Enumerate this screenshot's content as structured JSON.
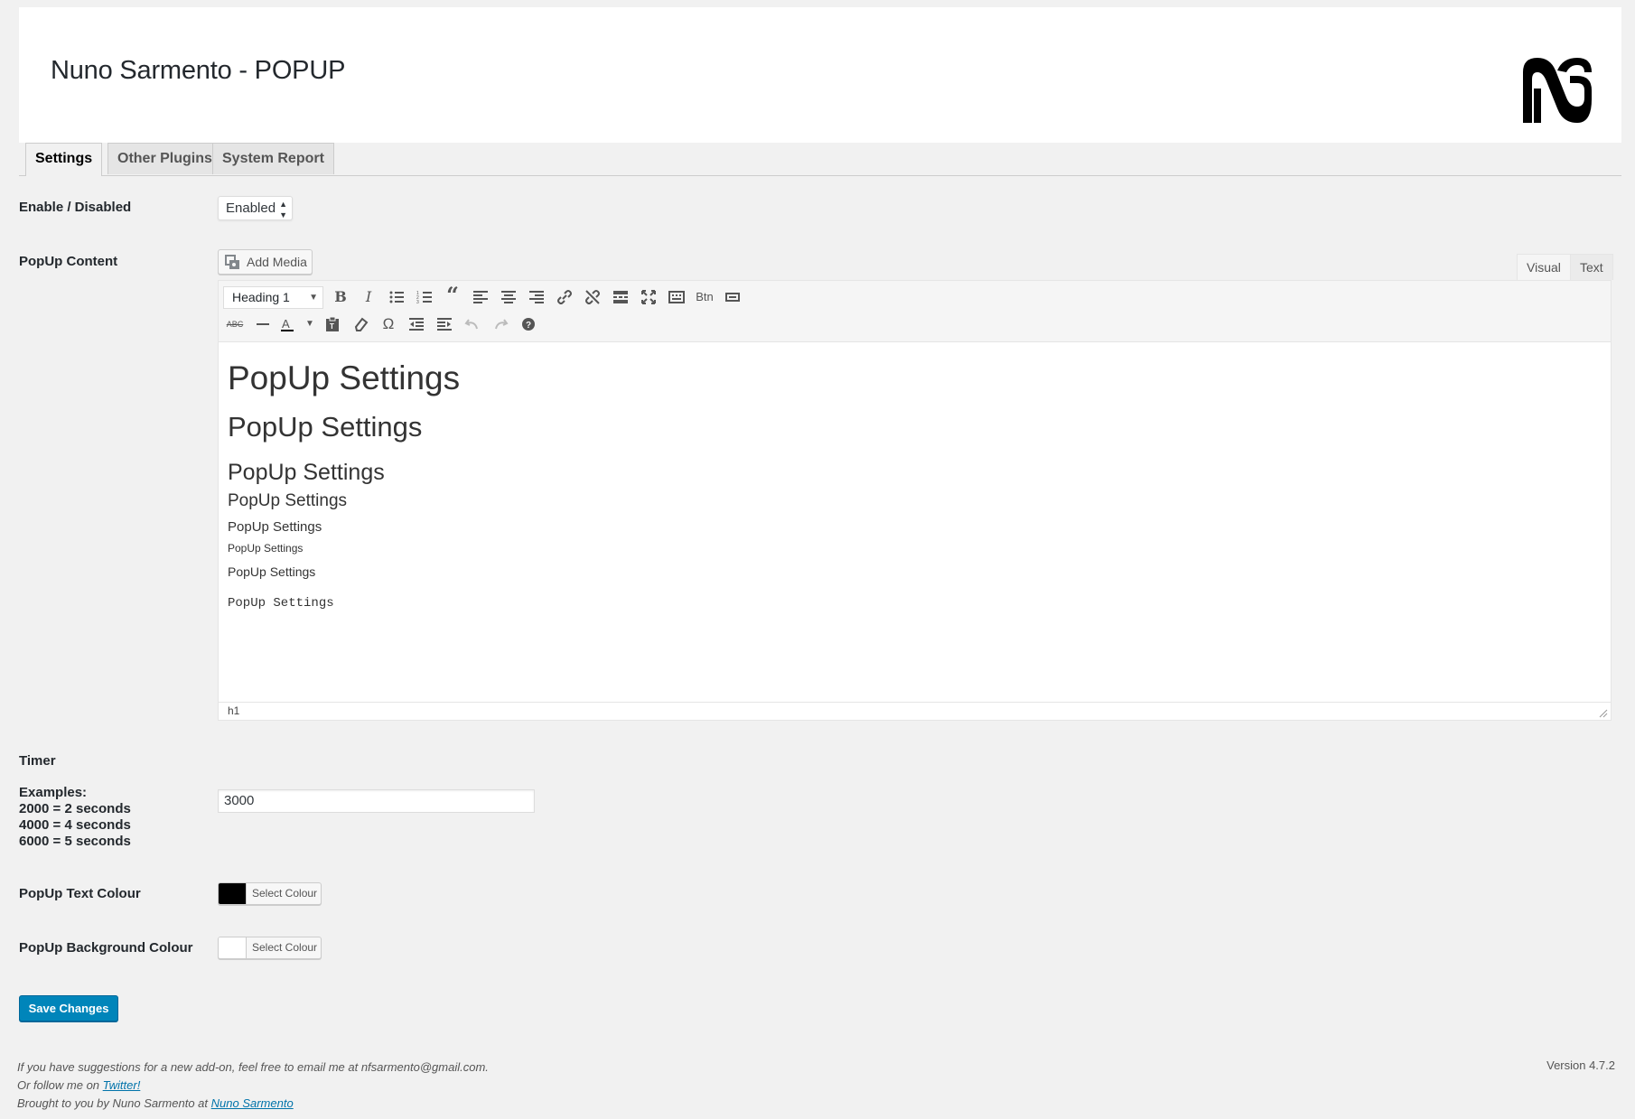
{
  "header": {
    "title": "Nuno Sarmento - POPUP",
    "logo": "ns-logo"
  },
  "tabs": [
    {
      "label": "Settings",
      "active": true
    },
    {
      "label": "Other Plugins",
      "active": false
    },
    {
      "label": "System Report",
      "active": false
    }
  ],
  "enable": {
    "label": "Enable / Disabled",
    "value": "Enabled"
  },
  "popup_content": {
    "label": "PopUp Content",
    "add_media": "Add Media",
    "modes": {
      "visual": "Visual",
      "text": "Text"
    },
    "format": "Heading 1",
    "toolbar_row1": [
      "bold-icon",
      "italic-icon",
      "bullet-list-icon",
      "numbered-list-icon",
      "blockquote-icon",
      "align-left-icon",
      "align-center-icon",
      "align-right-icon",
      "link-icon",
      "unlink-icon",
      "read-more-icon",
      "fullscreen-icon",
      "toolbar-toggle-icon",
      "button-shortcode",
      "shortcode-icon"
    ],
    "btn_label": "Btn",
    "toolbar_row2": [
      "strikethrough-icon",
      "horizontal-line-icon",
      "text-color-icon",
      "paste-text-icon",
      "clear-formatting-icon",
      "special-character-icon",
      "outdent-icon",
      "indent-icon",
      "undo-icon",
      "redo-icon",
      "help-icon"
    ],
    "content": {
      "h1": "PopUp Settings",
      "h2": "PopUp Settings",
      "h3": "PopUp Settings",
      "h4": "PopUp Settings",
      "h5": "PopUp Settings",
      "h6": "PopUp Settings",
      "p": "PopUp Settings",
      "pre": "PopUp Settings"
    },
    "status_path": "h1"
  },
  "timer": {
    "label": "Timer",
    "examples_title": "Examples:",
    "examples": [
      "2000 = 2 seconds",
      "4000 = 4 seconds",
      "6000 = 5 seconds"
    ],
    "value": "3000"
  },
  "text_colour": {
    "label": "PopUp Text Colour",
    "button": "Select Colour",
    "color": "#000000"
  },
  "bg_colour": {
    "label": "PopUp Background Colour",
    "button": "Select Colour",
    "color": "#ffffff"
  },
  "save": "Save Changes",
  "footer": {
    "line1": "If you have suggestions for a new add-on, feel free to email me at nfsarmento@gmail.com.",
    "line2_prefix": "Or follow me on ",
    "line2_link": "Twitter!",
    "line3_prefix": "Brought to you by Nuno Sarmento at ",
    "line3_link": "Nuno Sarmento",
    "version": "Version 4.7.2"
  },
  "colors": {
    "primary": "#0085ba",
    "link": "#0073aa",
    "background": "#f1f1f1"
  }
}
